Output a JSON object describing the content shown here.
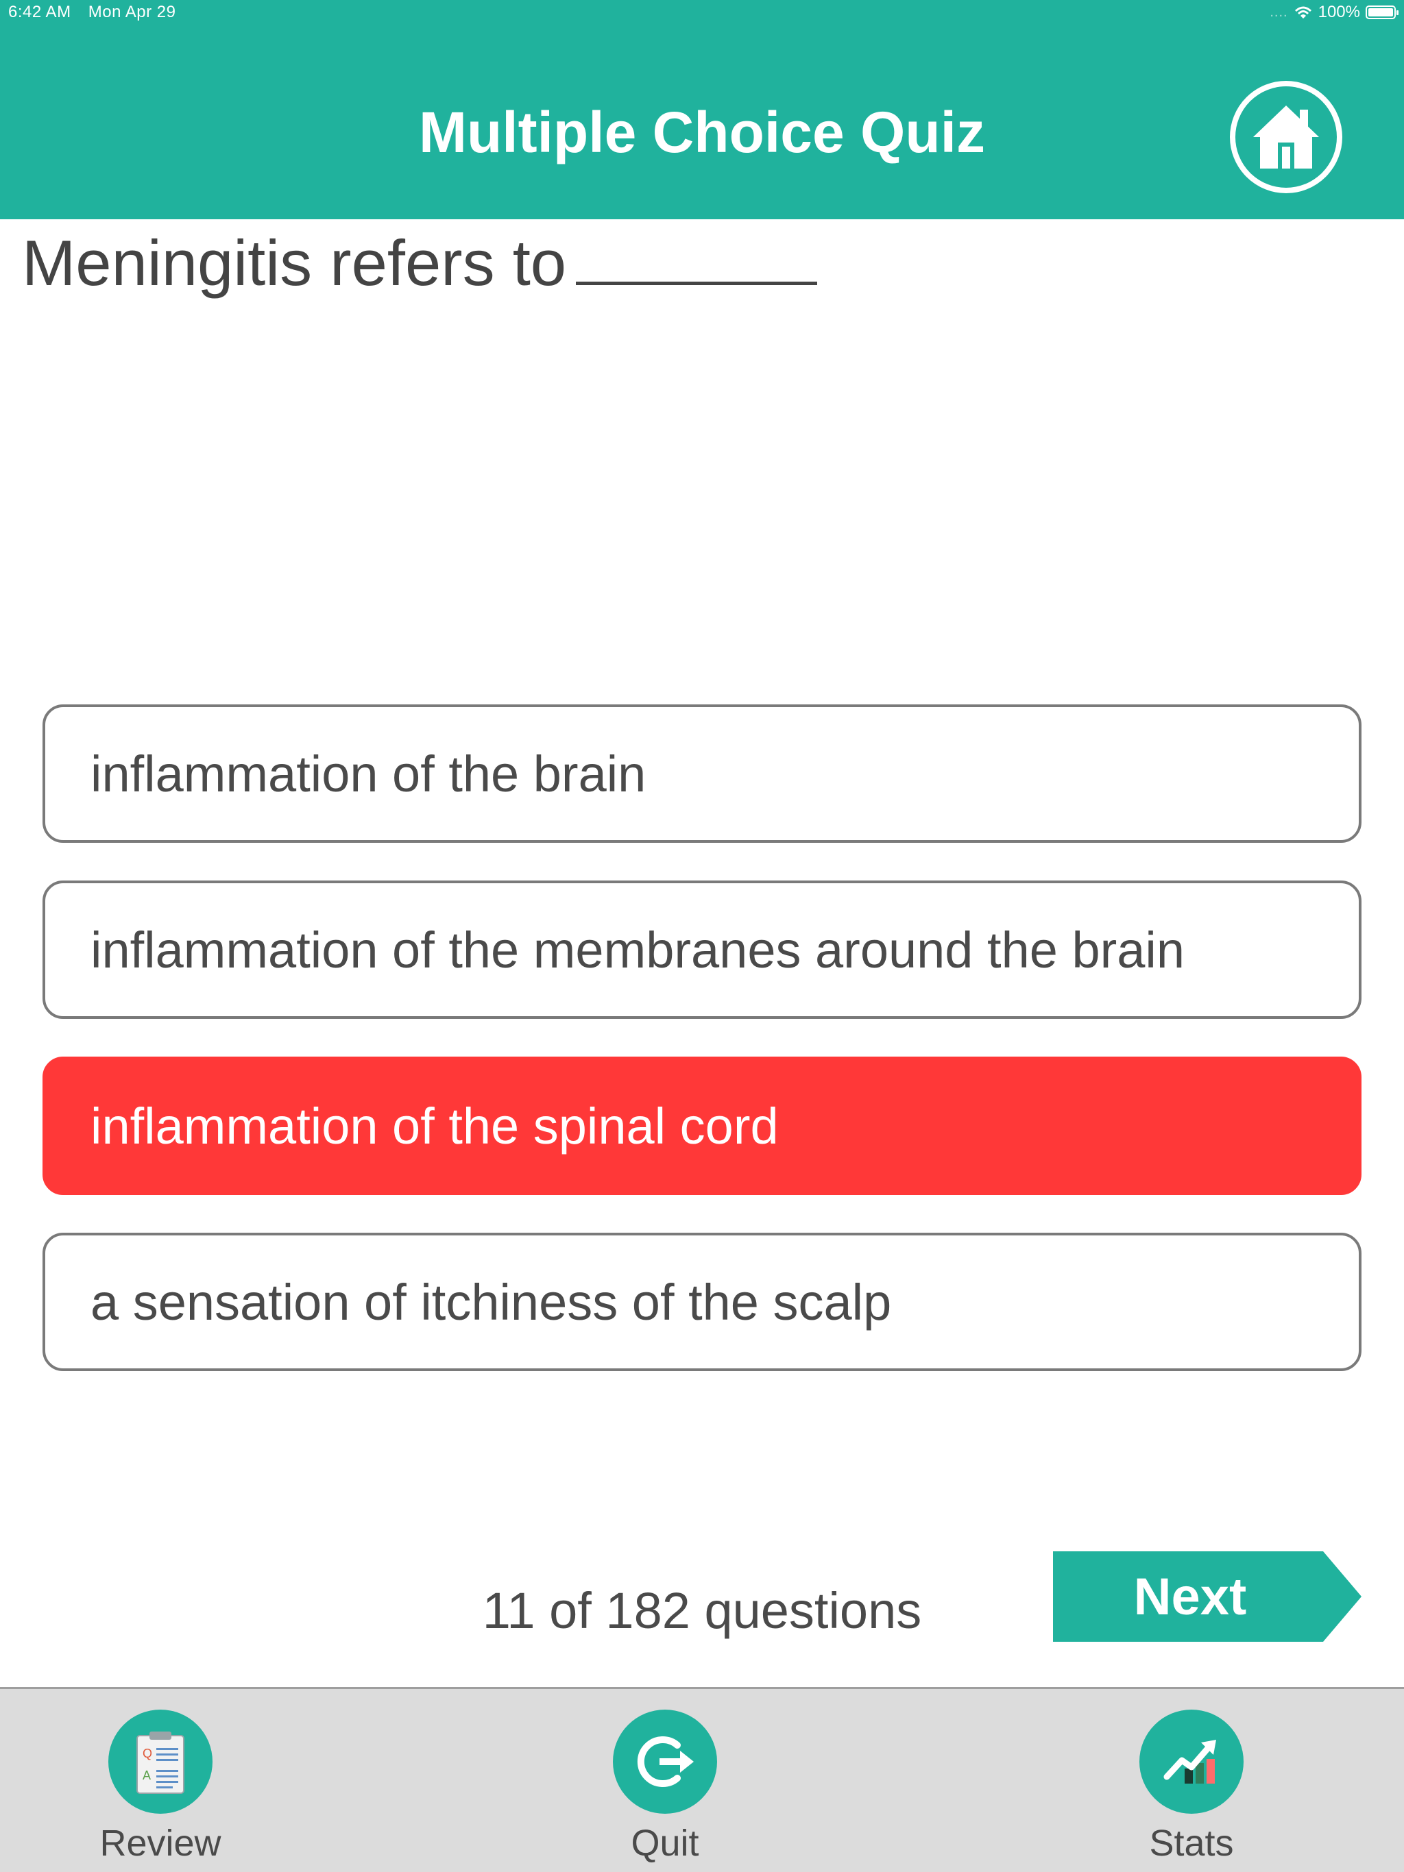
{
  "status_bar": {
    "time": "6:42 AM",
    "date": "Mon Apr 29",
    "battery": "100%"
  },
  "header": {
    "title": "Multiple Choice Quiz",
    "home_icon": "home-icon"
  },
  "question": {
    "text": "Meningitis refers to"
  },
  "options": [
    {
      "label": "inflammation of the brain",
      "state": "normal"
    },
    {
      "label": "inflammation of the membranes around the brain",
      "state": "normal"
    },
    {
      "label": "inflammation of the spinal cord",
      "state": "wrong"
    },
    {
      "label": "a sensation of itchiness of the scalp",
      "state": "normal"
    }
  ],
  "progress": {
    "text": "11 of 182 questions",
    "current": 11,
    "total": 182
  },
  "next_button": {
    "label": "Next"
  },
  "tabbar": {
    "review": {
      "label": "Review",
      "icon": "clipboard-qa-icon"
    },
    "quit": {
      "label": "Quit",
      "icon": "exit-arrow-icon"
    },
    "stats": {
      "label": "Stats",
      "icon": "chart-trend-icon"
    }
  },
  "colors": {
    "accent": "#20b29d",
    "wrong": "#ff3838",
    "text": "#4a4a4a",
    "tabbar_bg": "#dcdcdc"
  }
}
